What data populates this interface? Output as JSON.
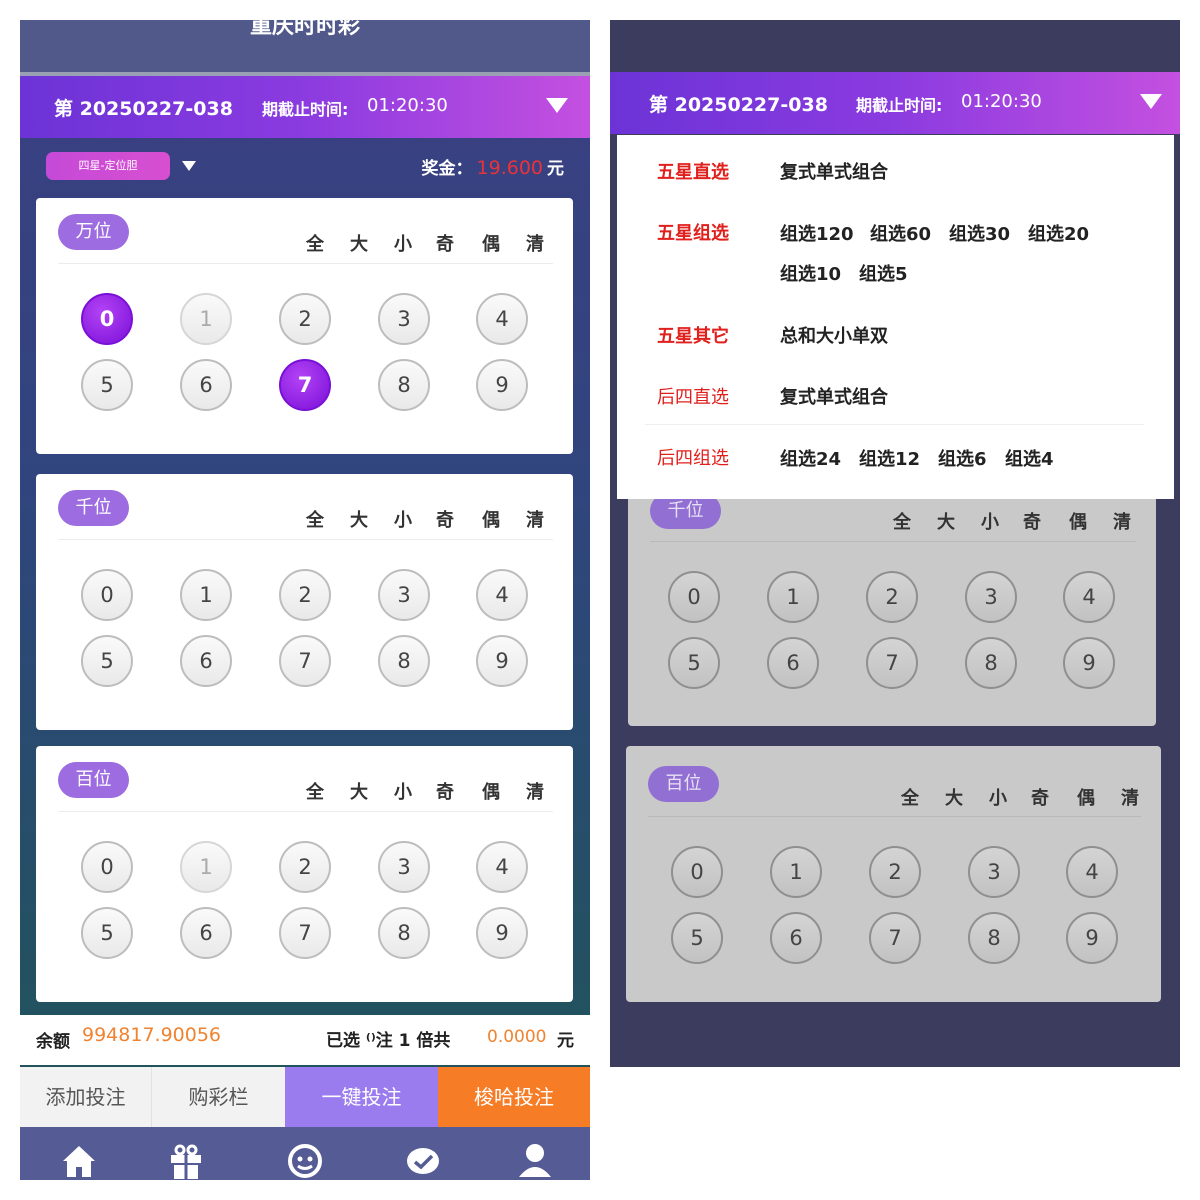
{
  "left": {
    "title": "重庆时时彩",
    "period": {
      "number": "第 20250227-038",
      "deadline_label": "期截止时间:",
      "deadline_time": "01:20:30"
    },
    "play_type": "四星-定位胆",
    "prize": {
      "label": "奖金：",
      "value": "19.600",
      "unit": "元"
    },
    "quick_picks": [
      "全",
      "大",
      "小",
      "奇",
      "偶",
      "清"
    ],
    "positions": [
      {
        "label": "万位",
        "selected": [
          0,
          7
        ]
      },
      {
        "label": "千位",
        "selected": []
      },
      {
        "label": "百位",
        "selected": []
      }
    ],
    "digits": [
      "0",
      "1",
      "2",
      "3",
      "4",
      "5",
      "6",
      "7",
      "8",
      "9"
    ],
    "balance": {
      "label": "余额",
      "value": "994817.90056"
    },
    "selection_summary": {
      "text": "已选 ⁽⁾注 1 倍共",
      "amount": "0.0000",
      "unit": "元"
    },
    "actions": [
      "添加投注",
      "购彩栏",
      "一键投注",
      "梭哈投注"
    ],
    "tabs": [
      "home-icon",
      "gift-icon",
      "service-icon",
      "message-icon",
      "user-icon"
    ]
  },
  "right": {
    "period": {
      "number": "第 20250227-038",
      "deadline_label": "期截止时间:",
      "deadline_time": "01:20:30"
    },
    "menu": [
      {
        "category": "五星直选",
        "options": [
          "复式单式组合"
        ]
      },
      {
        "category": "五星组选",
        "options": [
          "组选120",
          "组选60",
          "组选30",
          "组选20",
          "组选10",
          "组选5"
        ]
      },
      {
        "category": "五星其它",
        "options": [
          "总和大小单双"
        ]
      },
      {
        "category": "后四直选",
        "options": [
          "复式单式组合"
        ]
      },
      {
        "category": "后四组选",
        "options": [
          "组选24",
          "组选12",
          "组选6",
          "组选4"
        ]
      }
    ],
    "positions": [
      {
        "label": "千位"
      },
      {
        "label": "百位"
      }
    ]
  },
  "colors": {
    "accent_purple": "#7a10d8",
    "prize_red": "#e8333a",
    "balance_orange": "#f0832f",
    "bet_orange": "#f67d26",
    "menu_red": "#e0201c"
  }
}
